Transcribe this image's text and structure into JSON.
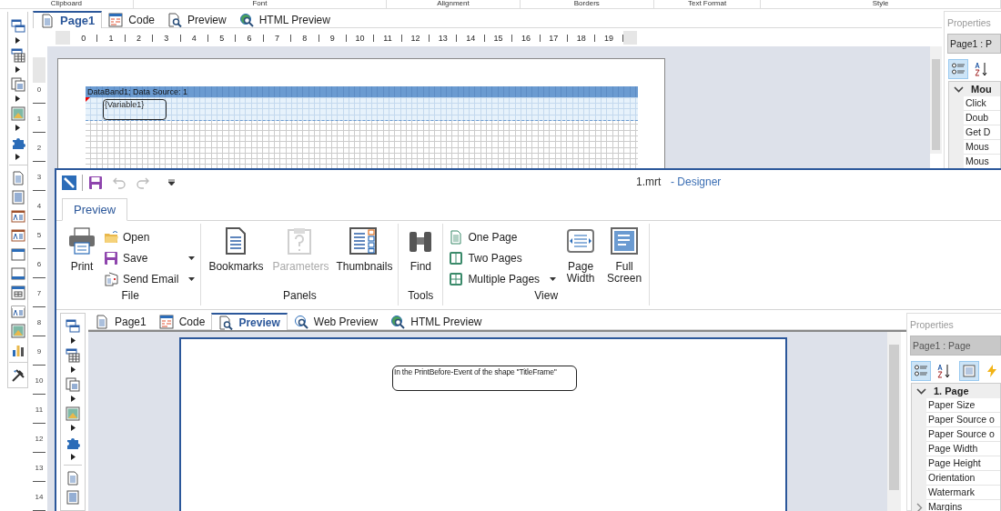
{
  "designer_window": {
    "ribbon_groups": [
      "Clipboard",
      "Font",
      "Alignment",
      "Borders",
      "Text Format",
      "Style"
    ],
    "tabs": [
      {
        "label": "Page1",
        "selected": true
      },
      {
        "label": "Code",
        "selected": false
      },
      {
        "label": "Preview",
        "selected": false
      },
      {
        "label": "HTML Preview",
        "selected": false
      }
    ],
    "ruler_h": [
      "0",
      "1",
      "2",
      "3",
      "4",
      "5",
      "6",
      "7",
      "8",
      "9",
      "10",
      "11",
      "12",
      "13",
      "14",
      "15",
      "16",
      "17",
      "18",
      "19"
    ],
    "ruler_v": [
      "0",
      "1",
      "2",
      "3",
      "4",
      "5",
      "6",
      "7",
      "8",
      "9",
      "10",
      "11",
      "12",
      "13",
      "14"
    ],
    "band_title": "DataBand1; Data Source: 1",
    "text_box": "{Variable1}",
    "properties": {
      "title": "Properties",
      "selector": "Page1 : P",
      "toolbar": [
        {
          "selected": true
        },
        {
          "selected": false
        }
      ],
      "category": {
        "label": "Mou",
        "expanded": true
      },
      "items": [
        "Click",
        "Doub",
        "Get D",
        "Mous",
        "Mous"
      ]
    }
  },
  "preview_window": {
    "title": "1.mrt",
    "app": "- Designer",
    "ribbon_tab": {
      "label": "Preview",
      "selected": true
    },
    "groups": [
      {
        "label": "File",
        "items": [
          {
            "kind": "large",
            "label": "Print",
            "disabled": false,
            "dropdown": false
          },
          {
            "kind": "small",
            "label": "Open",
            "disabled": false,
            "dropdown": false
          },
          {
            "kind": "small",
            "label": "Save",
            "disabled": false,
            "dropdown": true
          },
          {
            "kind": "small",
            "label": "Send Email",
            "disabled": false,
            "dropdown": true
          }
        ]
      },
      {
        "label": "Panels",
        "items": [
          {
            "kind": "large",
            "label": "Bookmarks",
            "disabled": false,
            "dropdown": false
          },
          {
            "kind": "large",
            "label": "Parameters",
            "disabled": true,
            "dropdown": false
          },
          {
            "kind": "large",
            "label": "Thumbnails",
            "disabled": false,
            "dropdown": false
          }
        ]
      },
      {
        "label": "Tools",
        "items": [
          {
            "kind": "large",
            "label": "Find",
            "disabled": false,
            "dropdown": false
          }
        ]
      },
      {
        "label": "View",
        "items": [
          {
            "kind": "small",
            "label": "One Page",
            "disabled": false,
            "dropdown": false
          },
          {
            "kind": "small",
            "label": "Two Pages",
            "disabled": false,
            "dropdown": false
          },
          {
            "kind": "small",
            "label": "Multiple Pages",
            "disabled": false,
            "dropdown": true
          },
          {
            "kind": "large",
            "label": "Page Width",
            "disabled": false,
            "dropdown": false
          },
          {
            "kind": "large",
            "label": "Full Screen",
            "disabled": false,
            "dropdown": false
          }
        ]
      }
    ],
    "tabs": [
      {
        "label": "Page1",
        "selected": false
      },
      {
        "label": "Code",
        "selected": false
      },
      {
        "label": "Preview",
        "selected": true
      },
      {
        "label": "Web Preview",
        "selected": false
      },
      {
        "label": "HTML Preview",
        "selected": false
      }
    ],
    "page_text": "In the PrintBefore-Event of the shape ''TitleFrame''",
    "properties": {
      "title": "Properties",
      "selector": "Page1 : Page",
      "toolbar": [
        {
          "selected": true
        },
        {
          "selected": false
        },
        {
          "selected": true
        },
        {
          "selected": false
        }
      ],
      "category": {
        "label": "1. Page",
        "expanded": true
      },
      "items": [
        {
          "label": "Paper Size"
        },
        {
          "label": "Paper Source o"
        },
        {
          "label": "Paper Source o"
        },
        {
          "label": "Page Width"
        },
        {
          "label": "Page Height"
        },
        {
          "label": "Orientation"
        },
        {
          "label": "Watermark"
        },
        {
          "label": "Margins",
          "expanded": false
        }
      ]
    }
  }
}
